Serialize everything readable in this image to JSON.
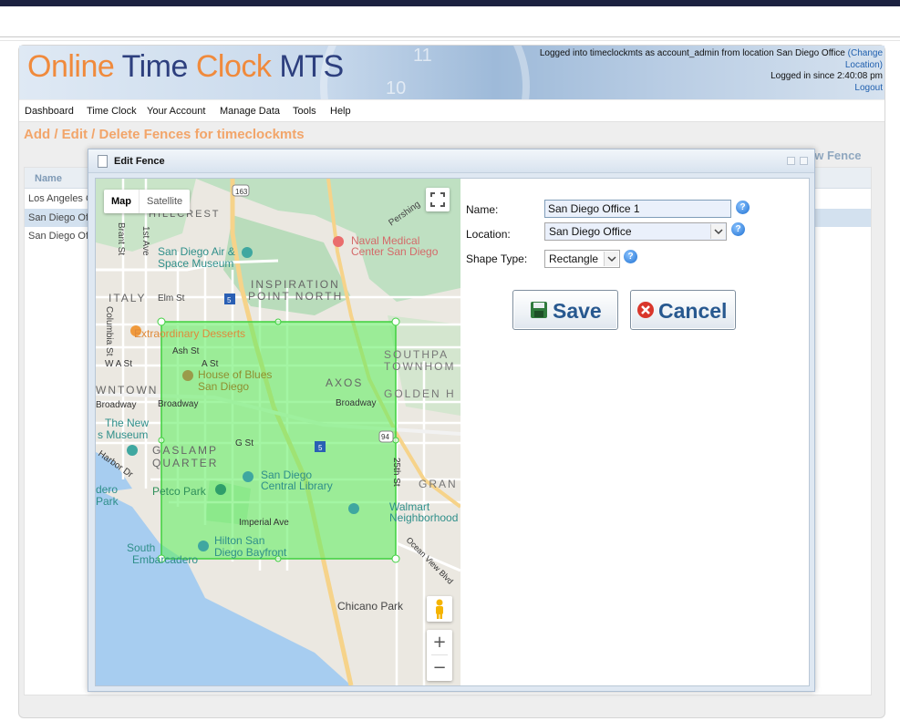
{
  "header": {
    "logo_part1": "Online",
    "logo_part2": "Time",
    "logo_part3": "Clock",
    "logo_part4": "MTS",
    "login_line1": "Logged into timeclockmts as account_admin from location San Diego Office",
    "change_location_open": "(Change",
    "change_location_close": "Location)",
    "login_line2": "Logged in since 2:40:08 pm",
    "logout": "Logout"
  },
  "menu": [
    "Dashboard",
    "Time Clock",
    "Your Account",
    "Manage Data",
    "Tools",
    "Help"
  ],
  "page": {
    "title": "Add / Edit / Delete Fences for timeclockmts",
    "new_fence_link": "ew Fence",
    "grid_header": "Name",
    "rows": [
      {
        "name": "Los Angeles C",
        "selected": false
      },
      {
        "name": "San Diego Of",
        "selected": true
      },
      {
        "name": "San Diego Of",
        "selected": false
      }
    ]
  },
  "dialog": {
    "title": "Edit Fence",
    "name_label": "Name:",
    "name_value": "San Diego Office 1",
    "location_label": "Location:",
    "location_value": "San Diego Office",
    "shape_label": "Shape Type:",
    "shape_value": "Rectangle",
    "save_label": "Save",
    "cancel_label": "Cancel"
  },
  "map": {
    "tab_map": "Map",
    "tab_satellite": "Satellite",
    "zoom_in": "+",
    "zoom_out": "−",
    "labels": {
      "hillcrest": "HILLCREST",
      "highway163": "163",
      "pershing": "Pershing",
      "naval_medical_1": "Naval Medical",
      "naval_medical_2": "Center San Diego",
      "brant": "Brant St",
      "first_ave": "1st Ave",
      "air_space_1": "San Diego Air &",
      "air_space_2": "Space Museum",
      "inspiration_1": "INSPIRATION",
      "inspiration_2": "POINT NORTH",
      "italy": "ITALY",
      "elm": "Elm St",
      "highway5a": "5",
      "columbia": "Columbia St",
      "desserts": "Extraordinary Desserts",
      "ash": "Ash St",
      "a_st": "A St",
      "wa_st": "W A St",
      "southpark_1": "SOUTHPA",
      "southpark_2": "TOWNHOM",
      "house_blues_1": "House of Blues",
      "house_blues_2": "San Diego",
      "axos": "AXOS",
      "downtown": "WNTOWN",
      "broadway1": "Broadway",
      "broadway2": "Broadway",
      "broadway3": "Broadway",
      "golden": "GOLDEN H",
      "new_museum_1": "The New",
      "new_museum_2": "s Museum",
      "g_st": "G St",
      "highway94": "94",
      "highway5b": "5",
      "gaslamp_1": "GASLAMP",
      "gaslamp_2": "QUARTER",
      "harbor": "Harbor Dr",
      "twentyfifth": "25th St",
      "library_1": "San Diego",
      "library_2": "Central Library",
      "grant": "GRAN",
      "dero_1": "dero",
      "dero_2": "Park",
      "petco": "Petco Park",
      "walmart_1": "Walmart",
      "walmart_2": "Neighborhood Ma",
      "imperial": "Imperial Ave",
      "south_1": "South",
      "south_2": "Embarcadero",
      "hilton_1": "Hilton San",
      "hilton_2": "Diego Bayfront",
      "oceanview": "Ocean View Blvd",
      "chicano": "Chicano Park"
    }
  },
  "colors": {
    "logo_orange": "#f08a3c",
    "logo_navy": "#2d3f7e",
    "page_title": "#f2a56a",
    "fence_fill": "#66ee66",
    "button_text": "#27588f"
  }
}
